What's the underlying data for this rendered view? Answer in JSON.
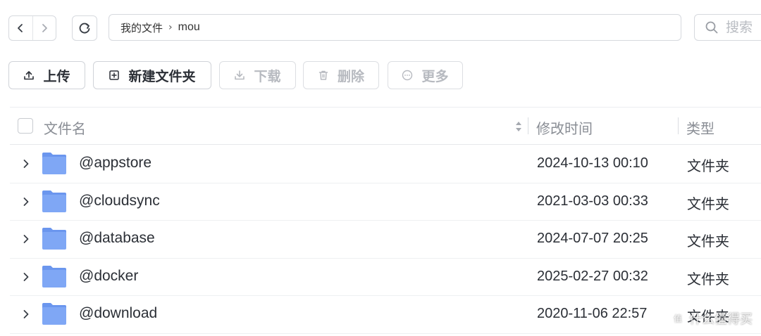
{
  "breadcrumb": {
    "root": "我的文件",
    "separator": "›",
    "current": "mou"
  },
  "search": {
    "placeholder": "搜索"
  },
  "toolbar": {
    "upload_label": "上传",
    "new_folder_label": "新建文件夹",
    "download_label": "下载",
    "delete_label": "删除",
    "more_label": "更多"
  },
  "table": {
    "columns": {
      "name": "文件名",
      "modified": "修改时间",
      "type": "类型"
    },
    "rows": [
      {
        "name": "@appstore",
        "modified": "2024-10-13 00:10",
        "type": "文件夹"
      },
      {
        "name": "@cloudsync",
        "modified": "2021-03-03 00:33",
        "type": "文件夹"
      },
      {
        "name": "@database",
        "modified": "2024-07-07 20:25",
        "type": "文件夹"
      },
      {
        "name": "@docker",
        "modified": "2025-02-27 00:32",
        "type": "文件夹"
      },
      {
        "name": "@download",
        "modified": "2020-11-06 22:57",
        "type": "文件夹"
      }
    ]
  },
  "watermark": {
    "text": "什么值得买"
  },
  "colors": {
    "folder": "#7fa7f5",
    "folder_tab": "#6b96ee",
    "border": "#d6d9de",
    "muted_text": "#8a8e95",
    "disabled_text": "#b7bac0"
  },
  "icons": {
    "back": "chevron-left-icon",
    "forward": "chevron-right-icon",
    "refresh": "refresh-icon",
    "search": "search-icon",
    "upload": "upload-icon",
    "new_folder": "new-folder-icon",
    "download": "download-icon",
    "delete": "trash-icon",
    "more": "more-icon",
    "expand": "chevron-right-icon",
    "folder": "folder-icon",
    "sort": "sort-icon"
  }
}
